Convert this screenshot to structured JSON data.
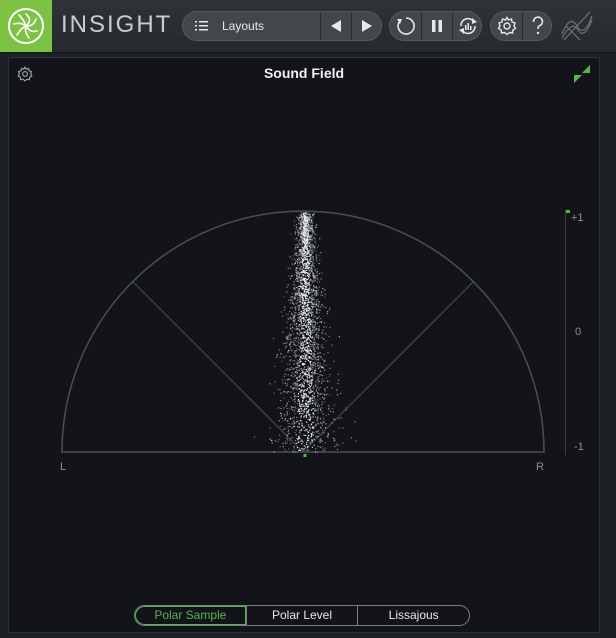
{
  "app": {
    "title": "INSIGHT",
    "brand_color": "#7dc242"
  },
  "toolbar": {
    "layouts_label": "Layouts",
    "icons": {
      "layouts": "list-icon",
      "prev": "triangle-left-icon",
      "next": "triangle-right-icon",
      "loop": "loop-icon",
      "pause": "pause-icon",
      "refresh_meters": "reset-meters-icon",
      "settings": "gear-icon",
      "help": "question-icon",
      "logo": "izotope-wave-icon"
    }
  },
  "panel": {
    "title": "Sound Field",
    "gear_icon": "gear-icon",
    "resize_icon": "collapse-arrows-icon",
    "channel_left": "L",
    "channel_right": "R",
    "scale": {
      "top": "+1",
      "middle": "0",
      "bottom": "-1"
    },
    "correlation_value": 1,
    "accent_color": "#55b64a"
  },
  "modes": {
    "active": "Polar Sample",
    "tabs": [
      {
        "label": "Polar Sample"
      },
      {
        "label": "Polar Level"
      },
      {
        "label": "Lissajous"
      }
    ]
  }
}
